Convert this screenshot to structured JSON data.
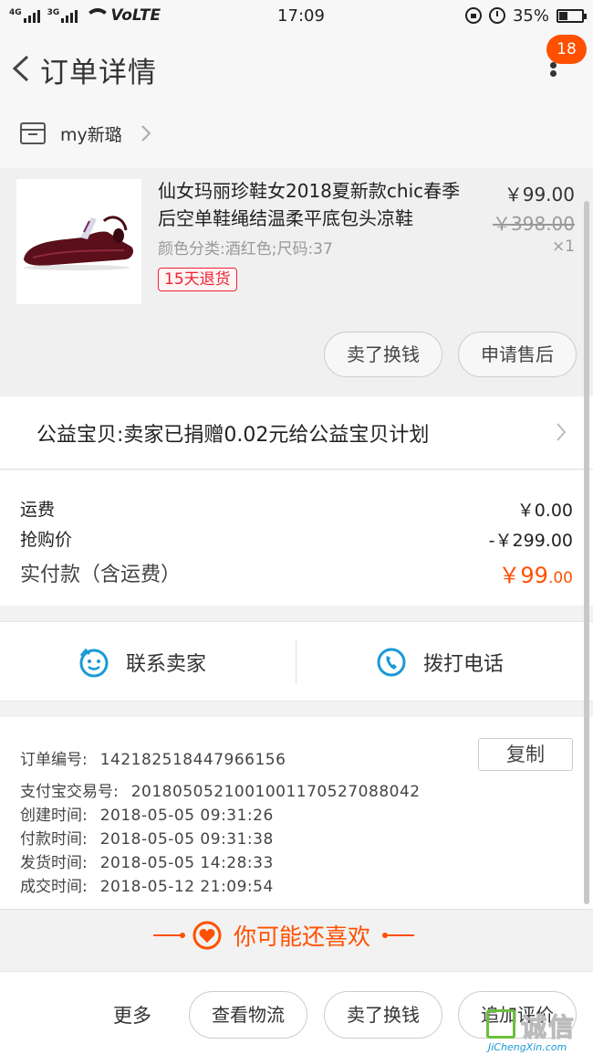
{
  "status_bar": {
    "sim1": "4G",
    "sim2": "3G",
    "network": "VoLTE",
    "time": "17:09",
    "battery": "35%"
  },
  "header": {
    "title": "订单详情",
    "badge_count": "18"
  },
  "shop": {
    "name": "my新璐"
  },
  "product": {
    "title": "仙女玛丽珍鞋女2018夏新款chic春季后空单鞋绳结温柔平底包头凉鞋",
    "sku": "颜色分类:酒红色;尺码:37",
    "refund_tag": "15天退货",
    "price": "￥99.00",
    "original_price": "￥398.00",
    "quantity": "×1",
    "sell_button": "卖了换钱",
    "after_sale_button": "申请售后"
  },
  "charity": {
    "text": "公益宝贝:卖家已捐赠0.02元给公益宝贝计划"
  },
  "fees": {
    "shipping_label": "运费",
    "shipping_value": "￥0.00",
    "discount_label": "抢购价",
    "discount_value": "-￥299.00",
    "total_label": "实付款（含运费）",
    "total_value_main": "￥99",
    "total_value_dec": ".00"
  },
  "contact": {
    "seller_label": "联系卖家",
    "phone_label": "拨打电话"
  },
  "order_info": {
    "copy_button": "复制",
    "rows": [
      {
        "key": "订单编号:",
        "value": "142182518447966156"
      },
      {
        "key": "支付宝交易号:",
        "value": "2018050521001001170527088042"
      },
      {
        "key": "创建时间:",
        "value": "2018-05-05 09:31:26"
      },
      {
        "key": "付款时间:",
        "value": "2018-05-05 09:31:38"
      },
      {
        "key": "发货时间:",
        "value": "2018-05-05 14:28:33"
      },
      {
        "key": "成交时间:",
        "value": "2018-05-12 21:09:54"
      }
    ]
  },
  "recommend": {
    "text": "你可能还喜欢"
  },
  "bottom_bar": {
    "more": "更多",
    "logistics": "查看物流",
    "sell": "卖了换钱",
    "review": "追加评价"
  },
  "watermark": {
    "cn": "诚信",
    "url": "JiChengXin.com"
  },
  "colors": {
    "accent": "#ff5000",
    "tag_red": "#ee2233",
    "icon_blue": "#1a9ad6"
  }
}
